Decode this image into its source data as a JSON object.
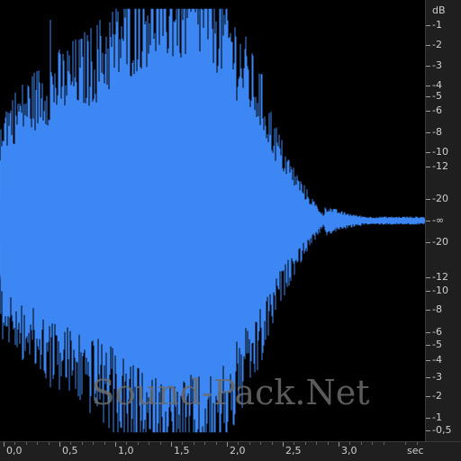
{
  "waveform": {
    "color": "#3d87f5",
    "color_highlight": "#5aa0ff",
    "background": "#000000",
    "duration_sec": 3.8
  },
  "db_scale": {
    "unit": "dB",
    "labels": [
      "-1",
      "-2",
      "-3",
      "-4",
      "-5",
      "-6",
      "-8",
      "-10",
      "-12",
      "-20",
      "-∞",
      "-20",
      "-12",
      "-10",
      "-8",
      "-6",
      "-5",
      "-4",
      "-3",
      "-2",
      "-1",
      "-0,5"
    ]
  },
  "time_ruler": {
    "unit": "sec",
    "labels": [
      "0,0",
      "0,5",
      "1,0",
      "1,5",
      "2,0",
      "2,5",
      "3,0"
    ]
  },
  "watermark": {
    "text": "Sound-Pack.Net"
  }
}
